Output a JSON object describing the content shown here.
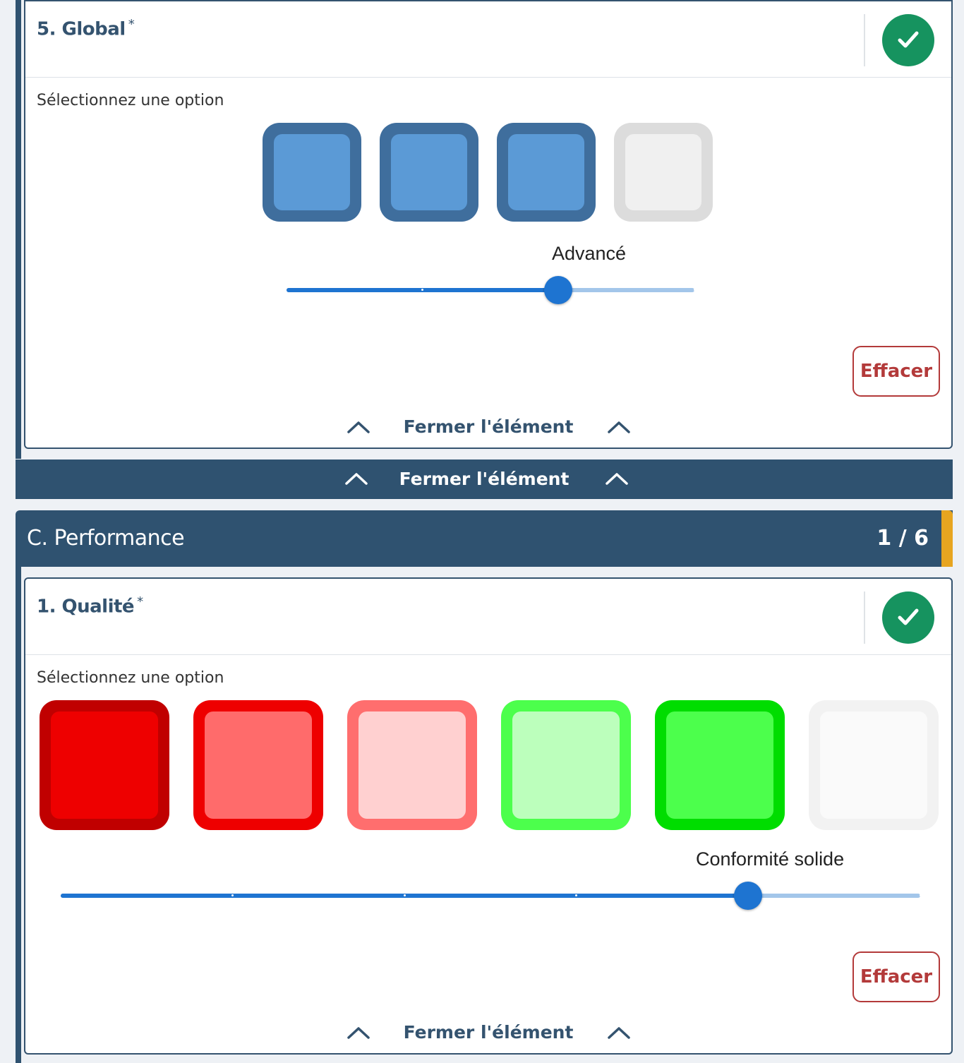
{
  "question_global": {
    "title": "5. Global",
    "required_mark": "*",
    "prompt": "Sélectionnez une option",
    "selected_label": "Advancé",
    "level": 3,
    "levels_total": 4,
    "clear_label": "Effacer",
    "close_label": "Fermer l'élément",
    "completed": true
  },
  "group_close": {
    "label": "Fermer l'élément"
  },
  "section": {
    "title": "C. Performance",
    "count": "1 / 6",
    "accent_color": "#e7a520"
  },
  "question_quality": {
    "title": "1. Qualité",
    "required_mark": "*",
    "prompt": "Sélectionnez une option",
    "selected_label": "Conformité solide",
    "level": 5,
    "levels_total": 6,
    "clear_label": "Effacer",
    "close_label": "Fermer l'élément",
    "completed": true
  },
  "colors": {
    "brand": "#2f5270",
    "success": "#16935f",
    "danger": "#b33a3a",
    "slider": "#1e74d1",
    "global_options": [
      {
        "border": "#3f6e9d",
        "fill": "#5b9ad6"
      },
      {
        "border": "#3f6e9d",
        "fill": "#5b9ad6"
      },
      {
        "border": "#3f6e9d",
        "fill": "#5b9ad6"
      },
      {
        "border": "#dcdcdc",
        "fill": "#f0f0f0"
      }
    ],
    "quality_options": [
      {
        "border": "#c00000",
        "fill": "#ee0000"
      },
      {
        "border": "#ee0000",
        "fill": "#ff6b6b"
      },
      {
        "border": "#ff6e6e",
        "fill": "#ffd0d0"
      },
      {
        "border": "#4cff4c",
        "fill": "#bcffbc"
      },
      {
        "border": "#00dd00",
        "fill": "#4cff4c"
      },
      {
        "border": "#f2f2f2",
        "fill": "#fafafa"
      }
    ]
  },
  "icons": {
    "check": "check-icon",
    "chevron": "chevron-up-icon"
  }
}
